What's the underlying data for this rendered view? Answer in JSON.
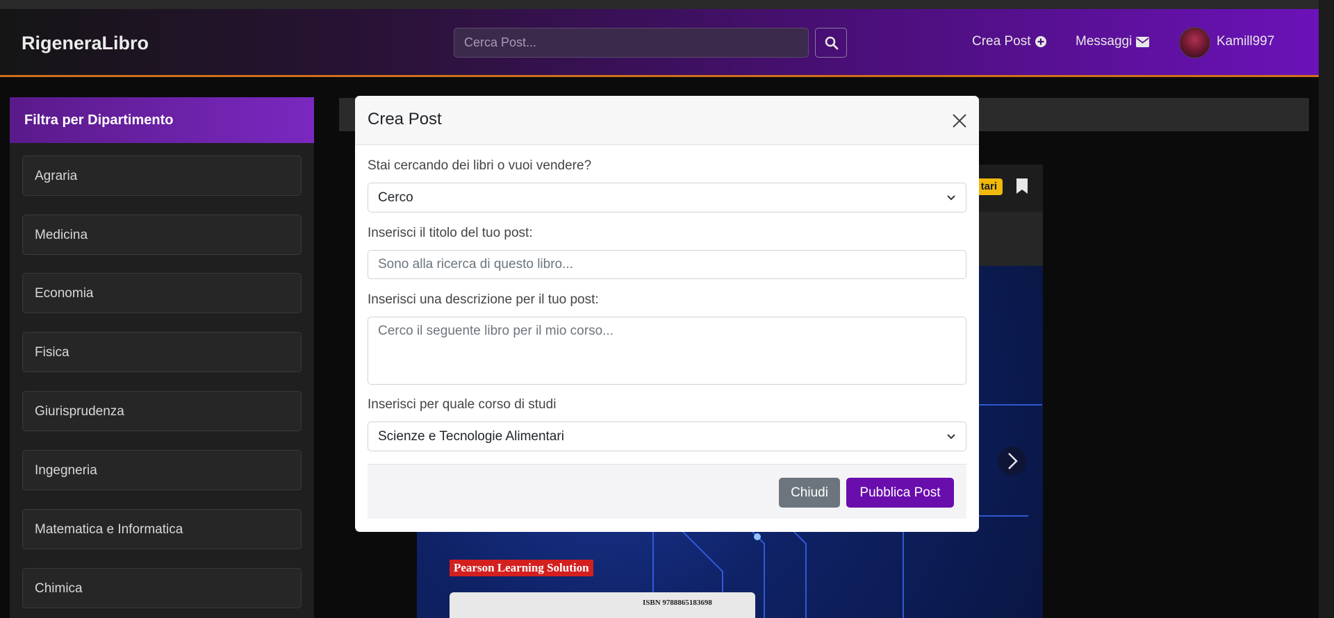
{
  "navbar": {
    "brand": "RigeneraLibro",
    "search_placeholder": "Cerca Post...",
    "create_post": "Crea Post",
    "messages": "Messaggi",
    "username": "Kamill997"
  },
  "sidebar": {
    "title": "Filtra per Dipartimento",
    "items": [
      "Agraria",
      "Medicina",
      "Economia",
      "Fisica",
      "Giurisprudenza",
      "Ingegneria",
      "Matematica e Informatica",
      "Chimica"
    ]
  },
  "background": {
    "badge_text": "tari",
    "cover_label": "Pearson Learning Solution",
    "isbn_text": "ISBN 9788865183698"
  },
  "modal": {
    "title": "Crea Post",
    "q1_label": "Stai cercando dei libri o vuoi vendere?",
    "q1_value": "Cerco",
    "title_label": "Inserisci il titolo del tuo post:",
    "title_placeholder": "Sono alla ricerca di questo libro...",
    "desc_label": "Inserisci una descrizione per il tuo post:",
    "desc_placeholder": "Cerco il seguente libro per il mio corso...",
    "course_label": "Inserisci per quale corso di studi",
    "course_value": "Scienze e Tecnologie Alimentari",
    "close_button": "Chiudi",
    "publish_button": "Pubblica Post"
  },
  "colors": {
    "accent_purple": "#6a0dad",
    "navbar_border_orange": "#d0701c",
    "badge_yellow": "#f0b90b"
  }
}
